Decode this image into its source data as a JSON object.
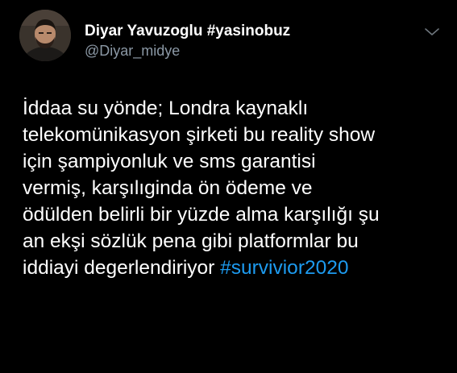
{
  "tweet": {
    "author": {
      "display_name": "Diyar Yavuzoglu #yasinobuz",
      "handle": "@Diyar_midye"
    },
    "text_lines": [
      "İddaa su yönde; Londra kaynaklı",
      "telekomünikasyon şirketi bu reality show",
      "için şampiyonluk ve sms garantisi",
      "vermiş, karşılıginda ön ödeme ve",
      "ödülden belirli bir yüzde alma karşılığı şu",
      "an ekşi sözlük pena gibi platformlar bu",
      "iddiayi degerlendiriyor"
    ],
    "hashtag": "#survivior2020"
  },
  "colors": {
    "background": "#000000",
    "text": "#ffffff",
    "secondary_text": "#8b98a5",
    "link": "#1d9bf0"
  },
  "icons": {
    "more_menu": "chevron-down-icon"
  }
}
